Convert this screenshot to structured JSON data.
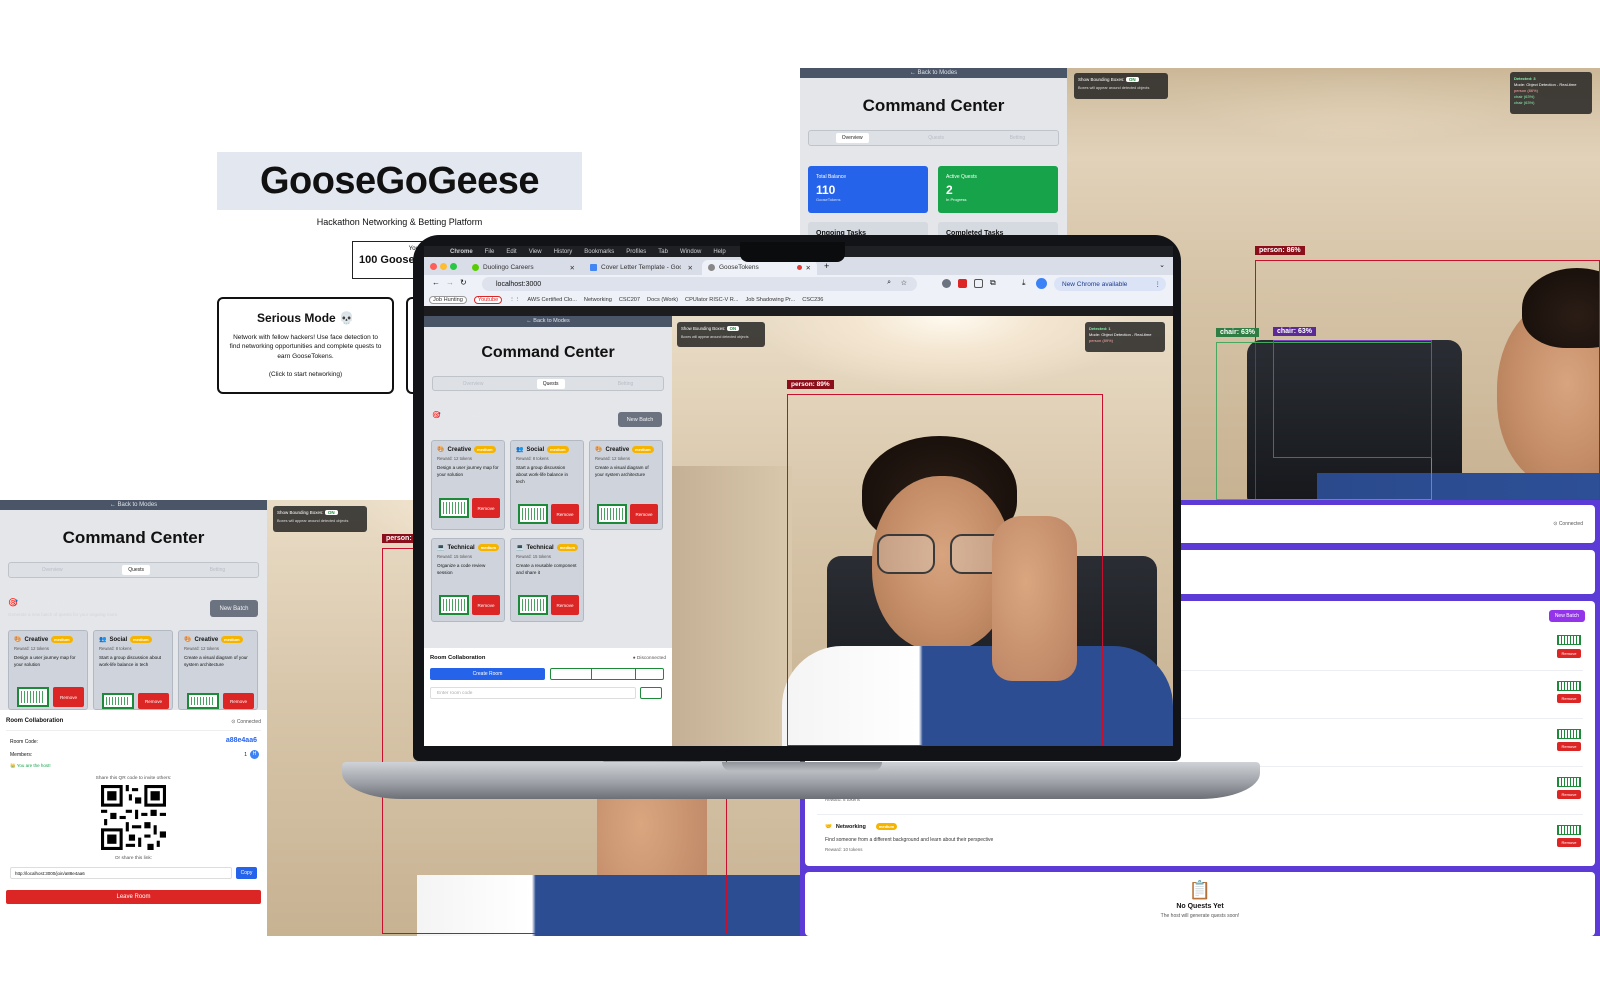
{
  "landing": {
    "title": "GooseGoGeese",
    "subtitle": "Hackathon Networking & Betting Platform",
    "tokens_prefix": "You have:",
    "tokens_value": "100 GooseT",
    "serious_mode": {
      "title": "Serious Mode 💀",
      "description": "Network with fellow hackers! Use face detection to find networking opportunities and complete quests to earn GooseTokens.",
      "hint": "(Click to start networking)"
    }
  },
  "top_right": {
    "back": "← Back to Modes",
    "title": "Command Center",
    "tabs": [
      "Overview",
      "Quests",
      "Betting"
    ],
    "active_tab": "Overview",
    "balance_label": "Total Balance",
    "balance_value": "110",
    "balance_unit": "GooseTokens",
    "active_label": "Active Quests",
    "active_value": "2",
    "active_sub": "In Progress",
    "ongoing": "Ongoing Tasks",
    "completed": "Completed Tasks",
    "bbox_toggle_label": "Show Bounding Boxes:",
    "bbox_toggle_value": "ON",
    "bbox_hint": "Boxes will appear around detected objects",
    "detected": "Detected: 3",
    "detected_mode": "Mode: Object Detection - Real-time",
    "detected_items": [
      "person (86%)",
      "chair (63%)",
      "chair (63%)"
    ],
    "labels": {
      "person": "person: 86%",
      "chair1": "chair: 63%",
      "chair2": "chair: 63%"
    }
  },
  "bottom_left": {
    "back": "← Back to Modes",
    "title": "Command Center",
    "tabs": [
      "Overview",
      "Quests",
      "Betting"
    ],
    "quest_batch": "🎯 Quest Batch",
    "quest_batch_sub": "Generate a new batch of quests for your ongoing room",
    "new_batch": "New Batch",
    "cards": [
      {
        "icon": "🎨",
        "type": "Creative",
        "difficulty": "medium",
        "reward": "Reward: 12 tokens",
        "desc": "Design a user journey map for your solution",
        "remove": "Remove"
      },
      {
        "icon": "👥",
        "type": "Social",
        "difficulty": "medium",
        "reward": "Reward: 8 tokens",
        "desc": "Start a group discussion about work-life balance in tech",
        "remove": "Remove"
      },
      {
        "icon": "🎨",
        "type": "Creative",
        "difficulty": "medium",
        "reward": "Reward: 12 tokens",
        "desc": "Create a visual diagram of your system architecture",
        "remove": "Remove"
      }
    ],
    "room_title": "Room Collaboration",
    "room_status": "⊙ Connected",
    "room_code_label": "Room Code:",
    "room_code": "a88e4aa6",
    "members_label": "Members:",
    "members_count": "1",
    "member_avatar": "H",
    "host_note": "👑 You are the host!",
    "qr_hint": "Share this QR code to invite others:",
    "link_hint": "Or share this link:",
    "link": "http://localhost:3000/join/a88e4aa6",
    "copy": "Copy",
    "leave": "Leave Room",
    "bbox_toggle_label": "Show Bounding Boxes:",
    "bbox_toggle_value": "ON",
    "bbox_hint": "Boxes will appear around detected objects",
    "person_label": "person:"
  },
  "right_list": {
    "status": "⊙ Connected",
    "new_batch": "New Batch",
    "remove": "Remove",
    "networking_title": "Networking",
    "networking_difficulty": "medium",
    "networking_desc": "Find someone from a different background and learn about their perspective",
    "networking_reward": "Reward: 10 tokens",
    "prev_reward": "Reward: 8 tokens",
    "empty_icon": "📋",
    "empty_title": "No Quests Yet",
    "empty_sub": "The host will generate quests soon!"
  },
  "laptop": {
    "menubar": [
      "Chrome",
      "File",
      "Edit",
      "View",
      "History",
      "Bookmarks",
      "Profiles",
      "Tab",
      "Window",
      "Help"
    ],
    "tabs": [
      {
        "label": "Duolingo Careers",
        "color": "#58cc02"
      },
      {
        "label": "Cover Letter Template - Goog",
        "color": "#4285f4"
      },
      {
        "label": "GooseTokens",
        "color": "#666666"
      }
    ],
    "url": "localhost:3000",
    "new_chrome": "New Chrome available",
    "bookmarks": [
      "Job Hunting",
      "Youtube",
      "AWS Certified Clo...",
      "Networking",
      "CSC207",
      "Docs (Work)",
      "CPUlator RISC-V R...",
      "Job Shadowing Pr...",
      "CSC236"
    ],
    "back": "← Back to Modes",
    "title": "Command Center",
    "tabs_app": [
      "Overview",
      "Quests",
      "Betting"
    ],
    "quest_batch": "🎯 Quest Batch",
    "new_batch": "New Batch",
    "cards": [
      {
        "icon": "🎨",
        "type": "Creative",
        "difficulty": "medium",
        "reward": "Reward: 12 tokens",
        "desc": "Design a user journey map for your solution",
        "remove": "Remove"
      },
      {
        "icon": "👥",
        "type": "Social",
        "difficulty": "medium",
        "reward": "Reward: 8 tokens",
        "desc": "Start a group discussion about work-life balance in tech",
        "remove": "Remove"
      },
      {
        "icon": "🎨",
        "type": "Creative",
        "difficulty": "medium",
        "reward": "Reward: 12 tokens",
        "desc": "Create a visual diagram of your system architecture",
        "remove": "Remove"
      },
      {
        "icon": "💻",
        "type": "Technical",
        "difficulty": "medium",
        "reward": "Reward: 15 tokens",
        "desc": "Organize a code review session",
        "remove": "Remove"
      },
      {
        "icon": "💻",
        "type": "Technical",
        "difficulty": "medium",
        "reward": "Reward: 15 tokens",
        "desc": "Create a reusable component and share it",
        "remove": "Remove"
      }
    ],
    "room_title": "Room Collaboration",
    "room_status": "● Disconnected",
    "create_room": "Create Room",
    "room_placeholder": "Enter room code",
    "bbox_toggle_label": "Show Bounding Boxes:",
    "bbox_toggle_value": "ON",
    "bbox_hint": "Boxes will appear around detected objects",
    "detected": "Detected: 1",
    "detected_mode": "Mode: Object Detection - Real-time",
    "detected_items": [
      "person (89%)"
    ],
    "person_label": "person: 89%"
  }
}
